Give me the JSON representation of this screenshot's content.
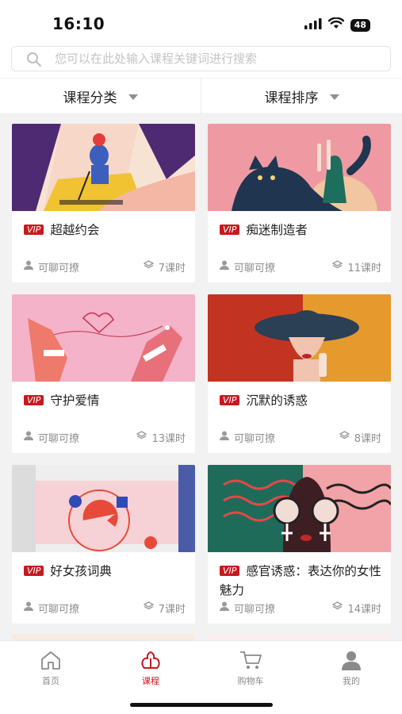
{
  "status_bar": {
    "time": "16:10",
    "battery": "48"
  },
  "search": {
    "placeholder": "您可以在此处输入课程关键词进行搜索"
  },
  "filters": [
    {
      "label": "课程分类"
    },
    {
      "label": "课程排序"
    }
  ],
  "vip_label": "VIP",
  "courses": [
    {
      "title": "超越约会",
      "author": "可聊可撩",
      "lessons": "7课时"
    },
    {
      "title": "痴迷制造者",
      "author": "可聊可撩",
      "lessons": "11课时"
    },
    {
      "title": "守护爱情",
      "author": "可聊可撩",
      "lessons": "13课时"
    },
    {
      "title": "沉默的诱惑",
      "author": "可聊可撩",
      "lessons": "8课时"
    },
    {
      "title": "好女孩词典",
      "author": "可聊可撩",
      "lessons": "7课时"
    },
    {
      "title": "感官诱惑：表达你的女性魅力",
      "author": "可聊可撩",
      "lessons": "14课时"
    }
  ],
  "tabs": [
    {
      "label": "首页",
      "icon": "home-icon",
      "active": false
    },
    {
      "label": "课程",
      "icon": "course-icon",
      "active": true
    },
    {
      "label": "购物车",
      "icon": "cart-icon",
      "active": false
    },
    {
      "label": "我的",
      "icon": "profile-icon",
      "active": false
    }
  ],
  "colors": {
    "accent": "#c8181f",
    "background": "#f2f2f2",
    "muted_text": "#8e8e8e"
  }
}
